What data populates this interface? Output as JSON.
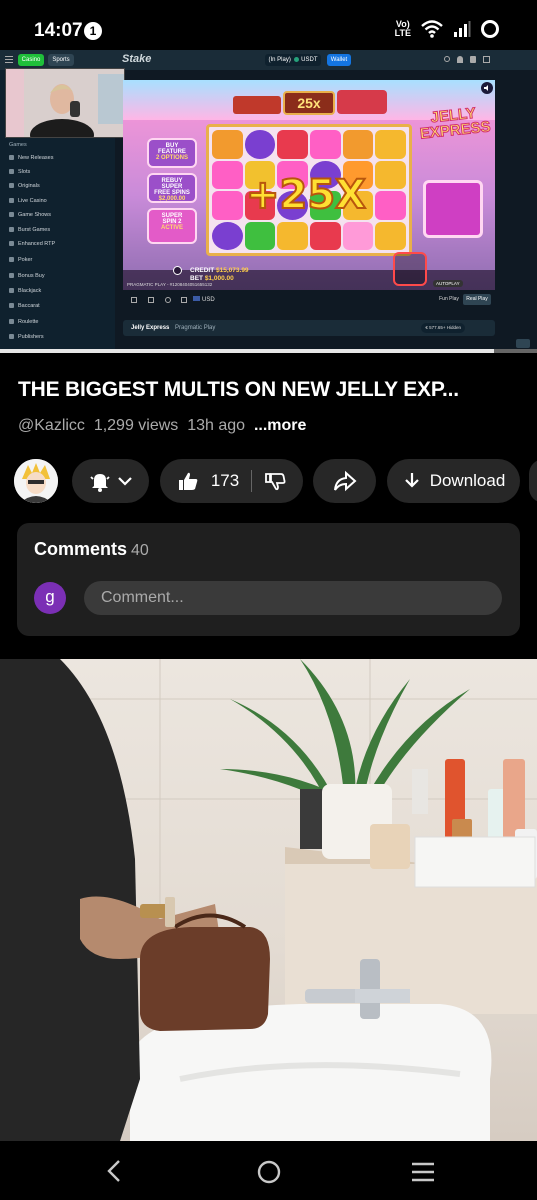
{
  "status_bar": {
    "time": "14:07",
    "notification_count": "1",
    "network_label_top": "Vo)",
    "network_label_bottom": "LTE"
  },
  "video": {
    "stake": {
      "tab_casino": "Casino",
      "tab_sports": "Sports",
      "logo": "Stake",
      "balance_label": "(In Play)",
      "currency": "USDT",
      "wallet_button": "Wallet",
      "section_heading": "Games",
      "sidebar_items": [
        "New Releases",
        "Slots",
        "Originals",
        "Live Casino",
        "Game Shows",
        "Burst Games",
        "Enhanced RTP",
        "Poker",
        "Bonus Buy",
        "Blackjack",
        "Baccarat",
        "Roulette",
        "Publishers"
      ],
      "game_name": "Jelly Express",
      "provider": "Pragmatic Play",
      "fun_play": "Fun Play",
      "real_play": "Real Play",
      "currency_select": "USD",
      "footer_stat": "€ 577.65+",
      "footer_hidden": "Hidden"
    },
    "game": {
      "top_multiplier": "25x",
      "big_multiplier": "+25X",
      "logo_line1": "JELLY",
      "logo_line2": "EXPRESS",
      "buy_feature_line1": "BUY",
      "buy_feature_line2": "FEATURE",
      "buy_feature_line3": "2 OPTIONS",
      "rebuy_line1": "REBUY SUPER",
      "rebuy_line2": "FREE SPINS",
      "rebuy_line3": "$2,000.00",
      "super_spin_line1": "SUPER",
      "super_spin_line2": "SPIN 2",
      "super_spin_line3": "ACTIVE",
      "credit_label": "CREDIT",
      "credit_value": "$15,073.99",
      "bet_label": "BET",
      "bet_value": "$1,000.00",
      "provider_tag": "PRAGMATIC PLAY - #1208404051655132",
      "autoplay": "AUTOPLAY"
    },
    "progress_fraction": 0.92
  },
  "title": "THE BIGGEST MULTIS ON NEW JELLY EXP...",
  "channel": "@Kazlicc",
  "views": "1,299 views",
  "age": "13h ago",
  "more_label": "...more",
  "actions": {
    "like_count": "173",
    "download_label": "Download"
  },
  "comments": {
    "title": "Comments",
    "count": "40",
    "user_initial": "g",
    "placeholder": "Comment..."
  },
  "colors": {
    "background": "#000000",
    "chip": "#272727",
    "card": "#1f1f1f",
    "comment_avatar": "#7b2fb5",
    "stake_green": "#1fbf3a",
    "stake_blue": "#1475e1"
  }
}
